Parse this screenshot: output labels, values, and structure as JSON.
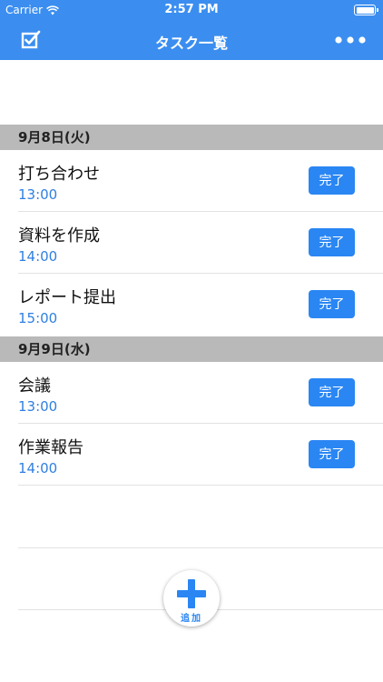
{
  "status_bar": {
    "carrier": "Carrier",
    "time": "2:57 PM"
  },
  "nav": {
    "title": "タスク一覧",
    "left_icon": "checkbox-edit-icon",
    "right_icon": "more-icon"
  },
  "sections": [
    {
      "header": "9月8日(火)",
      "tasks": [
        {
          "title": "打ち合わせ",
          "time": "13:00",
          "button": "完了"
        },
        {
          "title": "資料を作成",
          "time": "14:00",
          "button": "完了"
        },
        {
          "title": "レポート提出",
          "time": "15:00",
          "button": "完了"
        }
      ]
    },
    {
      "header": "9月9日(水)",
      "tasks": [
        {
          "title": "会議",
          "time": "13:00",
          "button": "完了"
        },
        {
          "title": "作業報告",
          "time": "14:00",
          "button": "完了"
        }
      ]
    }
  ],
  "fab": {
    "label": "追加",
    "icon": "plus-icon"
  },
  "colors": {
    "accent": "#3b8ef0",
    "button": "#2a86f3",
    "time_text": "#2f7fe0",
    "section_bg": "#b9b9b9"
  }
}
